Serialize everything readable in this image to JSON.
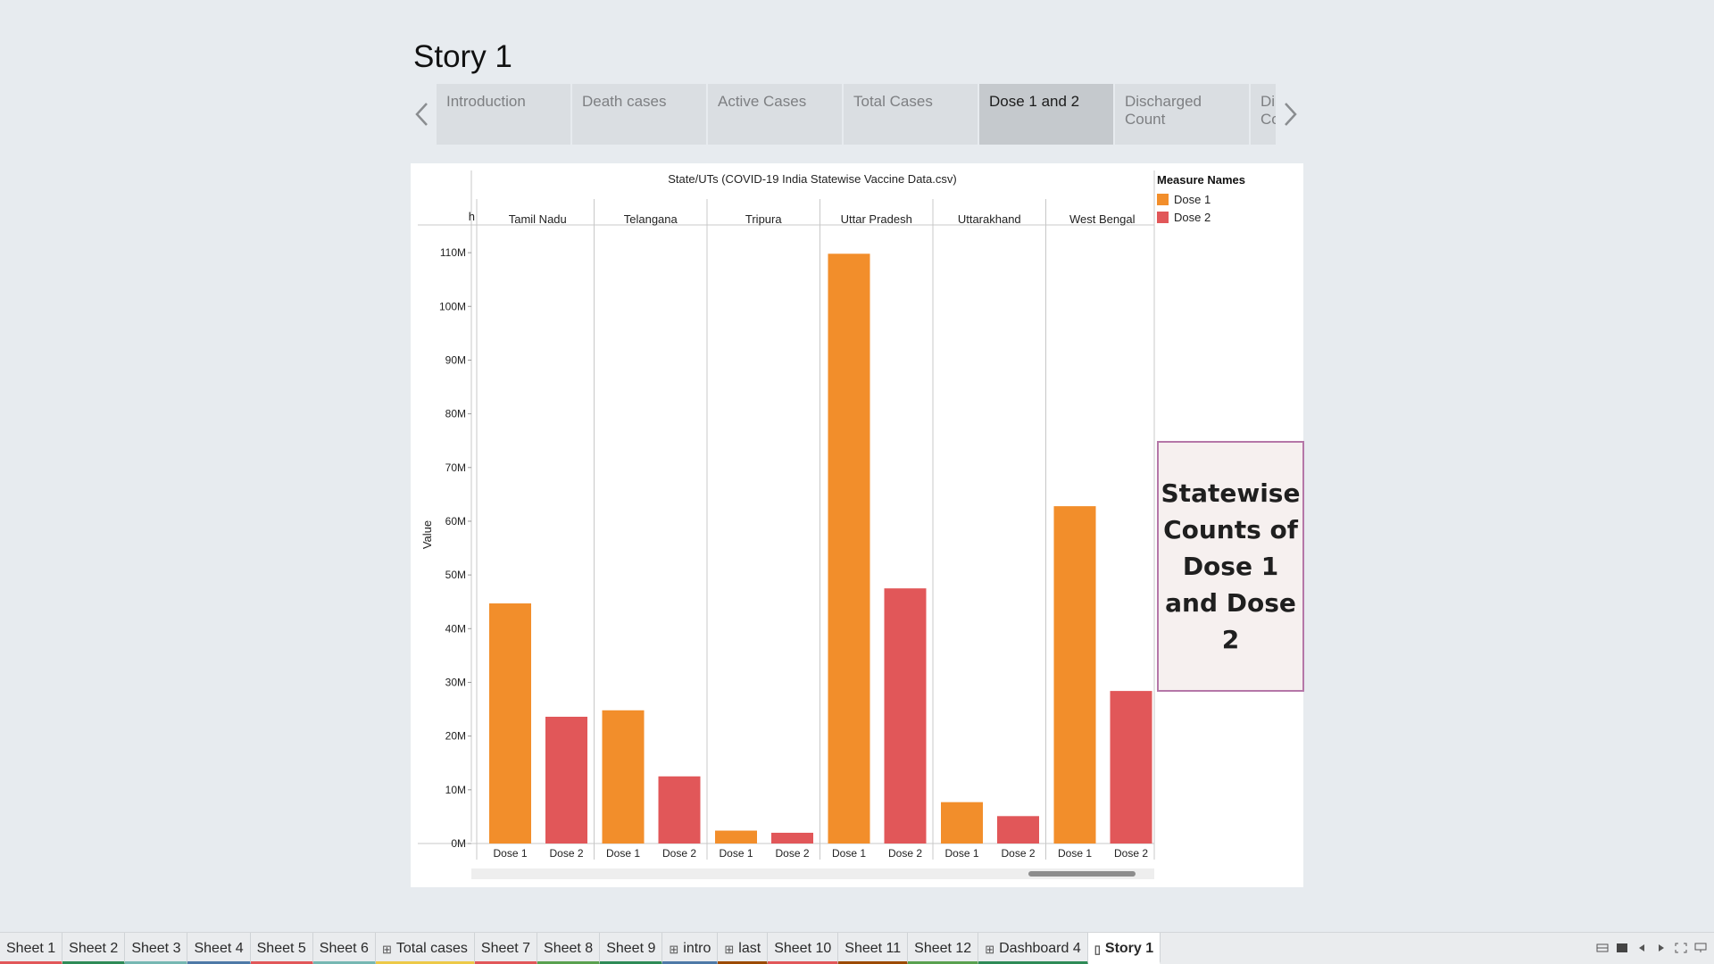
{
  "story": {
    "title": "Story 1",
    "points": [
      {
        "label": "Introduction",
        "active": false
      },
      {
        "label": "Death cases",
        "active": false
      },
      {
        "label": "Active Cases",
        "active": false
      },
      {
        "label": "Total Cases",
        "active": false
      },
      {
        "label": "Dose 1 and 2",
        "active": true
      },
      {
        "label": "Discharged Count",
        "active": false
      },
      {
        "label": "Di Co",
        "active": false
      }
    ]
  },
  "legend": {
    "title": "Measure Names",
    "items": [
      {
        "label": "Dose 1",
        "color": "#f28e2b"
      },
      {
        "label": "Dose 2",
        "color": "#e15759"
      }
    ]
  },
  "caption": {
    "text": "Statewise Counts of Dose 1 and Dose 2"
  },
  "chart_data": {
    "type": "bar",
    "title": "State/UTs (COVID-19 India Statewise Vaccine Data.csv)",
    "ylabel": "Value",
    "ylim": [
      0,
      115000000
    ],
    "yticks": [
      0,
      10000000,
      20000000,
      30000000,
      40000000,
      50000000,
      60000000,
      70000000,
      80000000,
      90000000,
      100000000,
      110000000
    ],
    "ytick_labels": [
      "0M",
      "10M",
      "20M",
      "30M",
      "40M",
      "50M",
      "60M",
      "70M",
      "80M",
      "90M",
      "100M",
      "110M"
    ],
    "categories": [
      "Tamil Nadu",
      "Telangana",
      "Tripura",
      "Uttar Pradesh",
      "Uttarakhand",
      "West Bengal"
    ],
    "partial_category_label": "h",
    "measures": [
      "Dose 1",
      "Dose 2"
    ],
    "series": [
      {
        "name": "Dose 1",
        "color": "#f28e2b",
        "values": [
          44700000,
          24800000,
          2400000,
          109800000,
          7700000,
          62800000
        ]
      },
      {
        "name": "Dose 2",
        "color": "#e15759",
        "values": [
          23600000,
          12500000,
          2000000,
          47500000,
          5100000,
          28400000
        ]
      }
    ],
    "grid": false,
    "legend_position": "right"
  },
  "sheet_tabs": [
    {
      "label": "Sheet 1",
      "icon": "",
      "color": "#e15759",
      "active": false
    },
    {
      "label": "Sheet 2",
      "icon": "",
      "color": "#2e8b57",
      "active": false
    },
    {
      "label": "Sheet 3",
      "icon": "",
      "color": "#76b7b2",
      "active": false
    },
    {
      "label": "Sheet 4",
      "icon": "",
      "color": "#4e79a7",
      "active": false
    },
    {
      "label": "Sheet 5",
      "icon": "",
      "color": "#e15759",
      "active": false
    },
    {
      "label": "Sheet 6",
      "icon": "",
      "color": "#76b7b2",
      "active": false
    },
    {
      "label": "Total cases",
      "icon": "dashboard-icon",
      "color": "#edc948",
      "active": false
    },
    {
      "label": "Sheet 7",
      "icon": "",
      "color": "#e15759",
      "active": false
    },
    {
      "label": "Sheet 8",
      "icon": "",
      "color": "#59a14f",
      "active": false
    },
    {
      "label": "Sheet 9",
      "icon": "",
      "color": "#2e8b57",
      "active": false
    },
    {
      "label": "intro",
      "icon": "dashboard-icon",
      "color": "#4e79a7",
      "active": false
    },
    {
      "label": "last",
      "icon": "dashboard-icon",
      "color": "#9c4a00",
      "active": false
    },
    {
      "label": "Sheet 10",
      "icon": "",
      "color": "#e15759",
      "active": false
    },
    {
      "label": "Sheet 11",
      "icon": "",
      "color": "#9c4a00",
      "active": false
    },
    {
      "label": "Sheet 12",
      "icon": "",
      "color": "#59a14f",
      "active": false
    },
    {
      "label": "Dashboard 4",
      "icon": "dashboard-icon",
      "color": "#2e8b57",
      "active": false
    },
    {
      "label": "Story 1",
      "icon": "story-icon",
      "color": "#ffffff",
      "active": true
    }
  ],
  "sheet_tools": [
    "filmstrip-icon",
    "tabs-icon",
    "prev-sheet-icon",
    "next-sheet-icon",
    "fullscreen-icon",
    "presentation-icon"
  ]
}
